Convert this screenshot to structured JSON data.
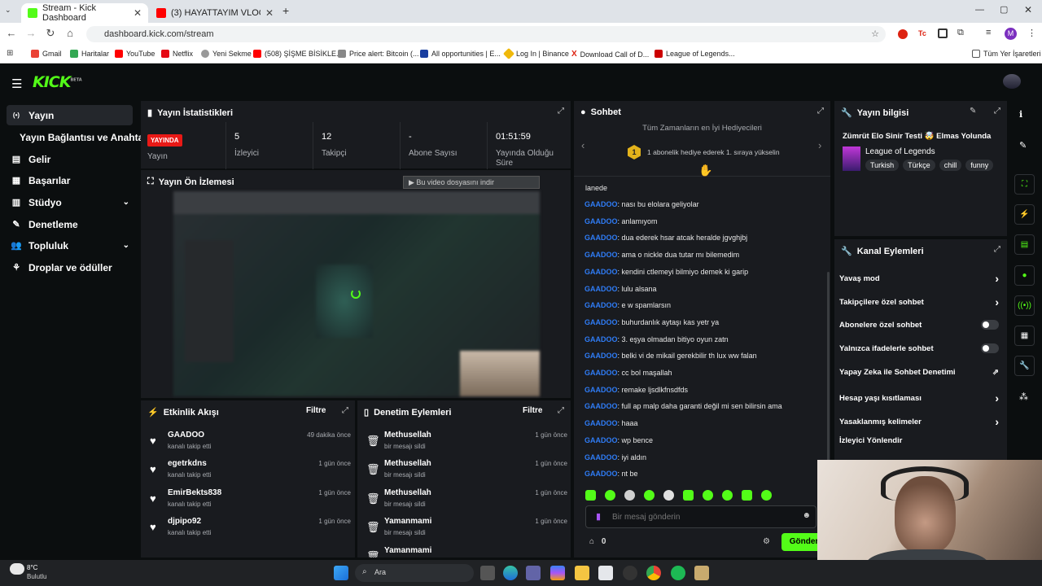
{
  "browser": {
    "tabs": [
      {
        "label": "Stream - Kick Dashboard",
        "active": true
      },
      {
        "label": "(3) HAYATTAYIM VLOG - YouTub",
        "active": false
      }
    ],
    "url": "dashboard.kick.com/stream",
    "bookmarks": [
      "Gmail",
      "Haritalar",
      "YouTube",
      "Netflix",
      "Yeni Sekme",
      "(508) ŞİŞME BİSİKLE...",
      "Price alert: Bitcoin (...",
      "All opportunities | E...",
      "Log In | Binance",
      "Download Call of D...",
      "League of Legends..."
    ],
    "bookmarks_all": "Tüm Yer İşaretleri",
    "profile_initial": "M"
  },
  "kick": {
    "logo": "KICK",
    "logo_badge": "BETA"
  },
  "nav": [
    {
      "label": "Yayın",
      "icon": "broadcast-icon"
    },
    {
      "label": "Yayın Bağlantısı ve Anahtarı"
    },
    {
      "label": "Gelir",
      "icon": "wallet-icon"
    },
    {
      "label": "Başarılar",
      "icon": "trophy-icon"
    },
    {
      "label": "Stüdyo",
      "icon": "studio-icon"
    },
    {
      "label": "Denetleme",
      "icon": "wrench-icon"
    },
    {
      "label": "Topluluk",
      "icon": "people-icon"
    },
    {
      "label": "Droplar ve ödüller",
      "icon": "gift-icon"
    }
  ],
  "stats": {
    "title": "Yayın İstatistikleri",
    "live_badge": "YAYINDA",
    "live_label": "Yayın",
    "viewers": "5",
    "viewers_label": "İzleyici",
    "followers": "12",
    "followers_label": "Takipçi",
    "subs": "-",
    "subs_label": "Abone Sayısı",
    "duration": "01:51:59",
    "duration_label": "Yayında Olduğu Süre"
  },
  "preview": {
    "title": "Yayın Ön İzlemesi",
    "download_label": "Bu video dosyasını indir"
  },
  "events": {
    "title": "Etkinlik Akışı",
    "filter": "Filtre",
    "items": [
      {
        "name": "GAADOO",
        "sub": "kanalı takip etti",
        "time": "49 dakika önce"
      },
      {
        "name": "egetrkdns",
        "sub": "kanalı takip etti",
        "time": "1 gün önce"
      },
      {
        "name": "EmirBekts838",
        "sub": "kanalı takip etti",
        "time": "1 gün önce"
      },
      {
        "name": "djpipo92",
        "sub": "kanalı takip etti",
        "time": "1 gün önce"
      }
    ]
  },
  "moderation": {
    "title": "Denetim Eylemleri",
    "filter": "Filtre",
    "items": [
      {
        "name": "Methusellah",
        "sub": "bir mesajı sildi",
        "time": "1 gün önce"
      },
      {
        "name": "Methusellah",
        "sub": "bir mesajı sildi",
        "time": "1 gün önce"
      },
      {
        "name": "Methusellah",
        "sub": "bir mesajı sildi",
        "time": "1 gün önce"
      },
      {
        "name": "Yamanmami",
        "sub": "bir mesajı sildi",
        "time": "1 gün önce"
      },
      {
        "name": "Yamanmami",
        "sub": "",
        "time": ""
      }
    ]
  },
  "chat": {
    "title": "Sohbet",
    "gifters_title": "Tüm Zamanların en İyi Hediyecileri",
    "gifters_rank": "1",
    "gifters_text": "1 abonelik hediye ederek 1. sıraya yükselin",
    "first_line": "lanede",
    "messages": [
      {
        "user": "GAADOO",
        "text": "nası bu elolara geliyolar"
      },
      {
        "user": "GAADOO",
        "text": "anlamıyom"
      },
      {
        "user": "GAADOO",
        "text": "dua ederek hsar atcak heralde jgvghjbj"
      },
      {
        "user": "GAADOO",
        "text": "ama o nickle dua tutar mı bilemedim"
      },
      {
        "user": "GAADOO",
        "text": "kendini ctlemeyi bilmiyo demek ki garip"
      },
      {
        "user": "GAADOO",
        "text": "lulu alsana"
      },
      {
        "user": "GAADOO",
        "text": "e w spamlarsın"
      },
      {
        "user": "GAADOO",
        "text": "buhurdanlık aytaşı kas yetr ya"
      },
      {
        "user": "GAADOO",
        "text": "3. eşya olmadan bitiyo oyun zatn"
      },
      {
        "user": "GAADOO",
        "text": "belki vi de mikail gerekbilir th lux ww falan"
      },
      {
        "user": "GAADOO",
        "text": "cc bol maşallah"
      },
      {
        "user": "GAADOO",
        "text": "remake ljsdlkfnsdfds"
      },
      {
        "user": "GAADOO",
        "text": "full ap malp daha garanti değil mi sen bilirsin ama"
      },
      {
        "user": "GAADOO",
        "text": "haaa"
      },
      {
        "user": "GAADOO",
        "text": "wp bence"
      },
      {
        "user": "GAADOO",
        "text": "iyi aldın"
      },
      {
        "user": "GAADOO",
        "text": "nt be"
      }
    ],
    "placeholder": "Bir mesaj gönderin",
    "points": "0",
    "send": "Gönder"
  },
  "stream_info": {
    "title": "Yayın bilgisi",
    "stream_title": "Zümrüt Elo Sinir Testi 🤯 Elmas Yolunda",
    "category": "League of Legends",
    "tags": [
      "Turkish",
      "Türkçe",
      "chill",
      "funny"
    ]
  },
  "channel_actions": {
    "title": "Kanal Eylemleri",
    "items": [
      {
        "label": "Yavaş mod",
        "control": "arrow"
      },
      {
        "label": "Takipçilere özel sohbet",
        "control": "arrow"
      },
      {
        "label": "Abonelere özel sohbet",
        "control": "toggle"
      },
      {
        "label": "Yalnızca ifadelerle sohbet",
        "control": "toggle"
      },
      {
        "label": "Yapay Zeka ile Sohbet Denetimi",
        "control": "external"
      },
      {
        "label": "Hesap yaşı kısıtlaması",
        "control": "arrow"
      },
      {
        "label": "Yasaklanmış kelimeler",
        "control": "arrow"
      },
      {
        "label": "İzleyici Yönlendir",
        "control": ""
      }
    ]
  },
  "taskbar": {
    "weather_temp": "8°C",
    "weather_desc": "Bulutlu",
    "search": "Ara"
  },
  "colors": {
    "accent": "#53fc18",
    "live": "#e91916",
    "username": "#2f7cf6",
    "panel": "#191b1f"
  }
}
